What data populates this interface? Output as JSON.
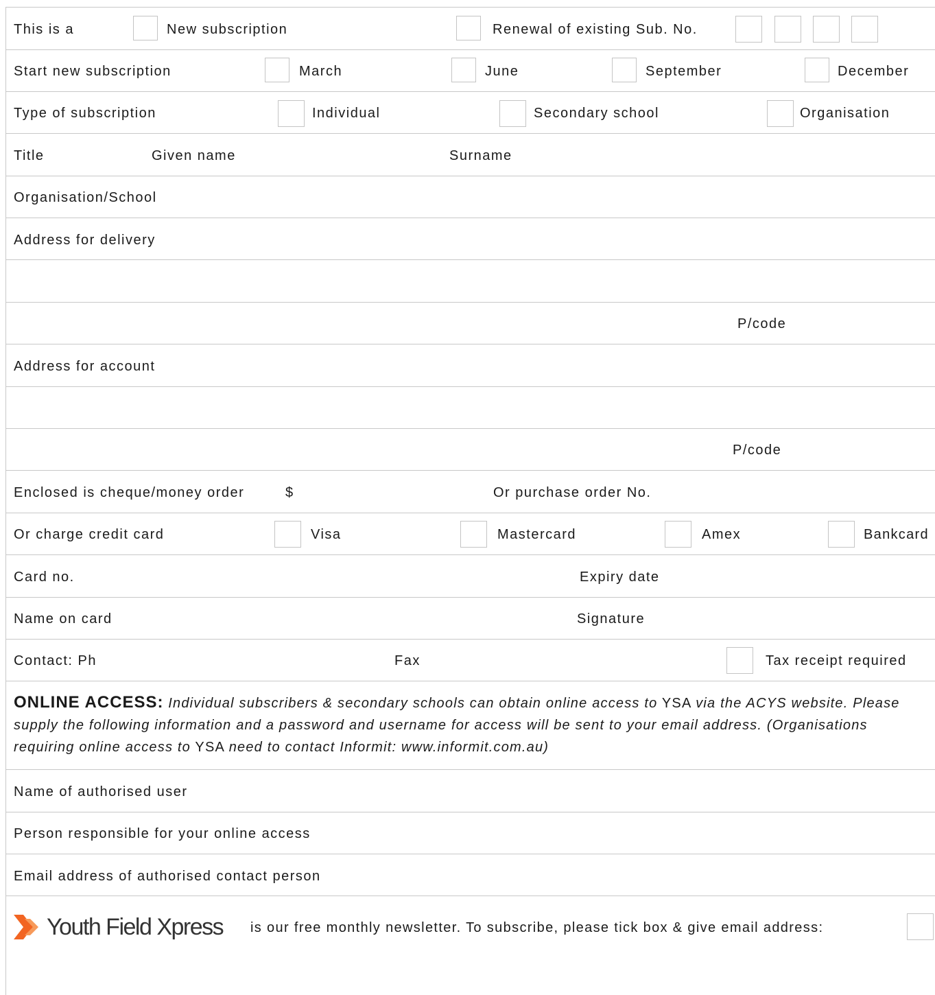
{
  "row1": {
    "label": "This is a",
    "new": "New subscription",
    "renewal": "Renewal of existing Sub. No."
  },
  "row2": {
    "label": "Start new subscription",
    "m1": "March",
    "m2": "June",
    "m3": "September",
    "m4": "December"
  },
  "row3": {
    "label": "Type of subscription",
    "o1": "Individual",
    "o2": "Secondary school",
    "o3": "Organisation"
  },
  "row4": {
    "title": "Title",
    "given": "Given name",
    "surname": "Surname"
  },
  "row5": {
    "label": "Organisation/School"
  },
  "row6": {
    "label": "Address for delivery"
  },
  "row8": {
    "pcode": "P/code"
  },
  "row9": {
    "label": "Address for account"
  },
  "row11": {
    "pcode": "P/code"
  },
  "row12": {
    "label": "Enclosed is cheque/money order",
    "dollar": "$",
    "po": "Or purchase order No."
  },
  "row13": {
    "label": "Or charge credit card",
    "c1": "Visa",
    "c2": "Mastercard",
    "c3": "Amex",
    "c4": "Bankcard"
  },
  "row14": {
    "card": "Card no.",
    "expiry": "Expiry date"
  },
  "row15": {
    "name": "Name on card",
    "signature": "Signature"
  },
  "row16": {
    "ph": "Contact:  Ph",
    "fax": "Fax",
    "tax": "Tax receipt required"
  },
  "online": {
    "heading": "ONLINE ACCESS:",
    "p1": "Individual subscribers & secondary schools can obtain online access to",
    "ysa1": "YSA",
    "p2": "via the ACYS website. Please supply the following information and a password and username for access will be sent to your email address. (Organisations requiring online access to",
    "ysa2": "YSA",
    "p3": "need to contact Informit: www.informit.com.au)"
  },
  "row18": {
    "label": "Name of authorised user"
  },
  "row19": {
    "label": "Person responsible for your online access"
  },
  "row20": {
    "label": "Email address of authorised contact person"
  },
  "newsletter": {
    "brand": "Youth Field Xpress",
    "text": "is our free monthly newsletter. To subscribe, please tick box & give email address:"
  },
  "colors": {
    "rule": "#c8c8c8",
    "chevron": "#f26522"
  }
}
